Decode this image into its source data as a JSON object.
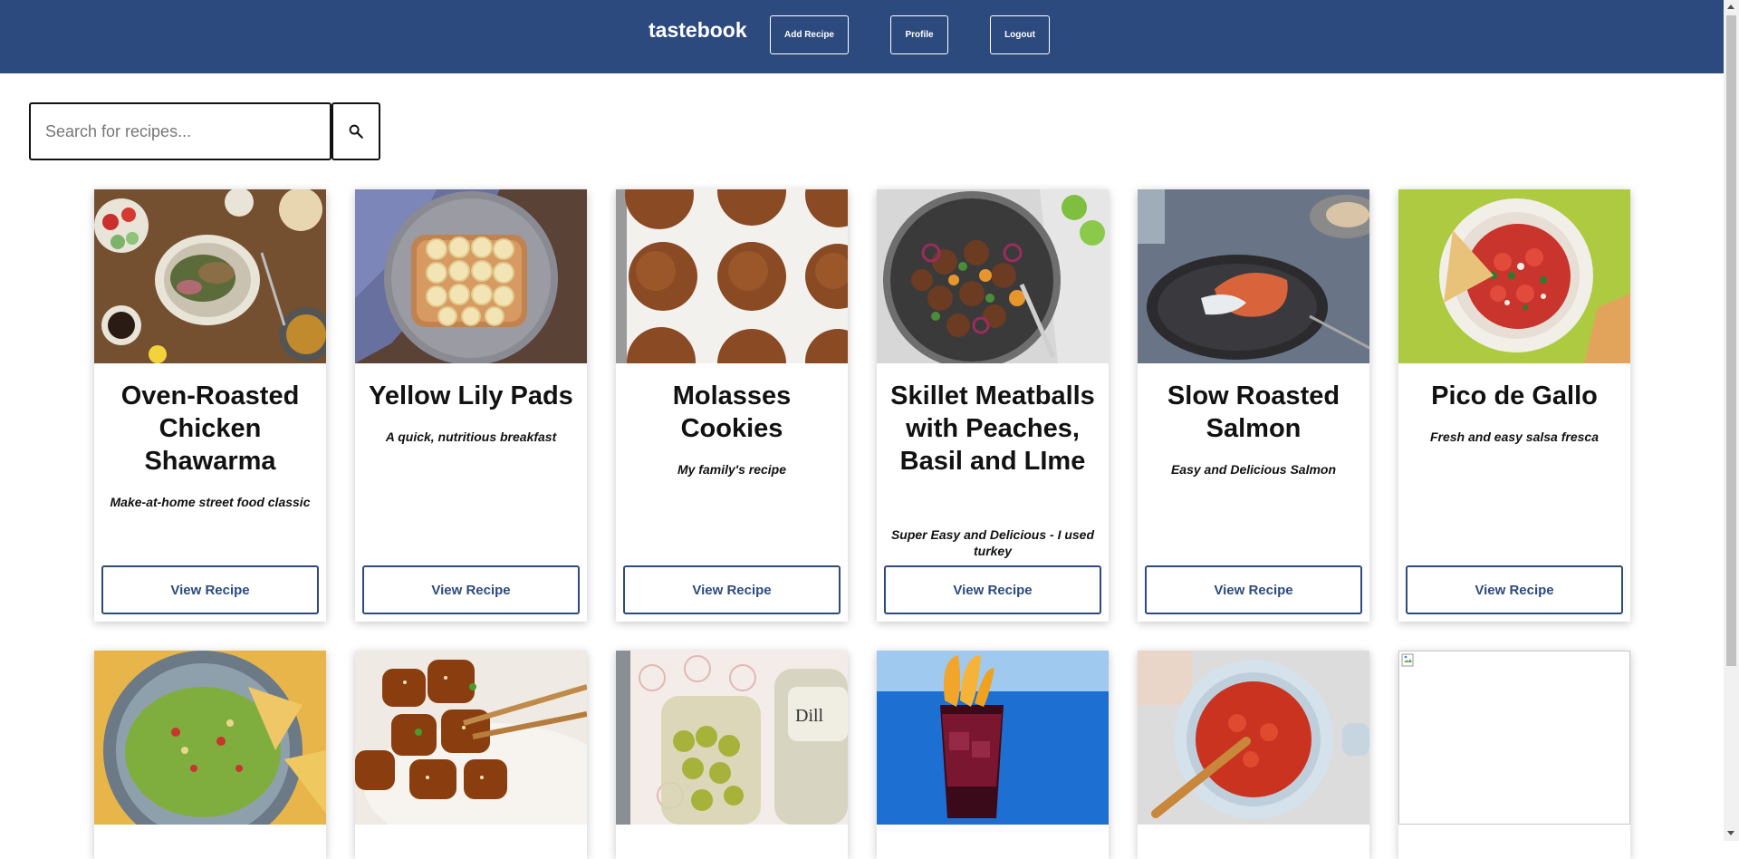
{
  "app": {
    "brand": "tastebook",
    "nav": [
      {
        "label": "Add Recipe"
      },
      {
        "label": "Profile"
      },
      {
        "label": "Logout"
      }
    ]
  },
  "search": {
    "placeholder": "Search for recipes...",
    "value": "",
    "button_icon": "search-icon"
  },
  "recipes": [
    {
      "title": "Oven-Roasted Chicken Shawarma",
      "subtitle": "Make-at-home street food classic",
      "button": "View Recipe",
      "image": "chicken-shawarma-photo"
    },
    {
      "title": "Yellow Lily Pads",
      "subtitle": "A quick, nutritious breakfast",
      "button": "View Recipe",
      "image": "banana-toast-photo"
    },
    {
      "title": "Molasses Cookies",
      "subtitle": "My family's recipe",
      "button": "View Recipe",
      "image": "molasses-cookies-photo"
    },
    {
      "title": "Skillet Meatballs with Peaches, Basil and LIme",
      "subtitle": "Super Easy and Delicious - I used turkey",
      "button": "View Recipe",
      "image": "meatball-skillet-photo"
    },
    {
      "title": "Slow Roasted Salmon",
      "subtitle": "Easy and Delicious Salmon",
      "button": "View Recipe",
      "image": "roasted-salmon-photo"
    },
    {
      "title": "Pico de Gallo",
      "subtitle": "Fresh and easy salsa fresca",
      "button": "View Recipe",
      "image": "pico-de-gallo-photo"
    },
    {
      "image": "guacamole-photo"
    },
    {
      "image": "sesame-chicken-photo"
    },
    {
      "image": "pickle-jars-photo",
      "jar_label": "Dill"
    },
    {
      "image": "cocktail-photo"
    },
    {
      "image": "tomato-sauce-photo"
    },
    {
      "image": "broken-image"
    }
  ],
  "colors": {
    "navbar": "#2d4a7f",
    "accent": "#2d4a7f",
    "page_bg": "#ffffff"
  }
}
